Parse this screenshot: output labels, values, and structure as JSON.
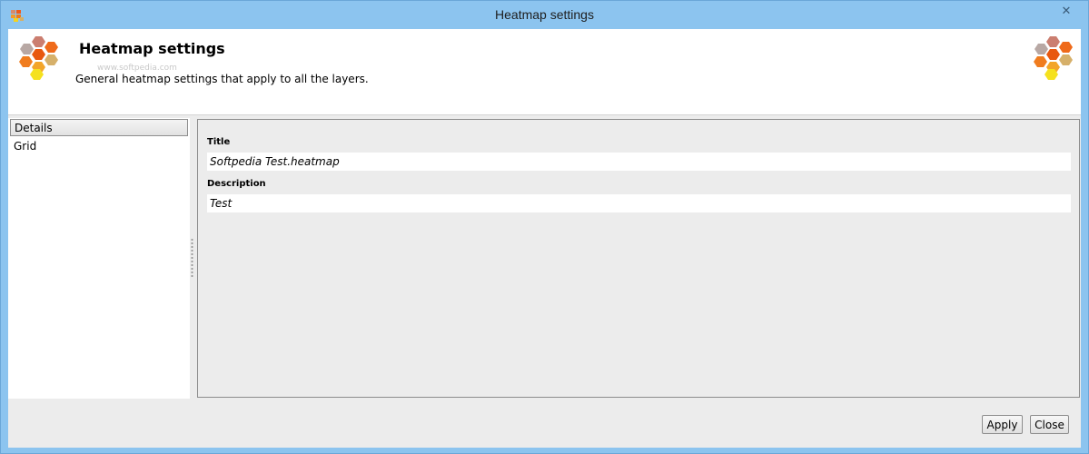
{
  "window": {
    "title": "Heatmap settings",
    "close_glyph": "✕"
  },
  "header": {
    "title": "Heatmap settings",
    "watermark": "www.softpedia.com",
    "description": "General heatmap settings that apply to all the layers.",
    "logo_icon": "heatmap-hexagons-icon"
  },
  "sidebar": {
    "items": [
      {
        "label": "Details",
        "selected": true
      },
      {
        "label": "Grid",
        "selected": false
      }
    ]
  },
  "details": {
    "title_label": "Title",
    "title_value": "Softpedia Test.heatmap",
    "description_label": "Description",
    "description_value": "Test"
  },
  "buttons": {
    "apply": "Apply",
    "close": "Close"
  },
  "colors": {
    "titlebar": "#8cc4ef",
    "hex_grey": "#c9a79a",
    "hex_orange": "#ef7a1a",
    "hex_yellow": "#f5e11e"
  }
}
